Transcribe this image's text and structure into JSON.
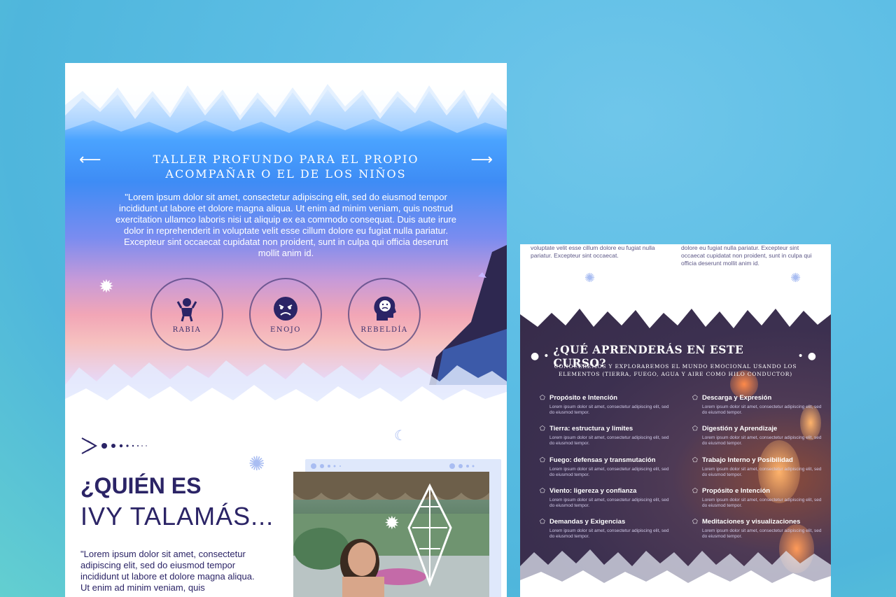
{
  "hero": {
    "title": "Taller profundo para el propio acompañar o el de los niños",
    "arrow_left": "⟵",
    "arrow_right": "⟶",
    "text": "\"Lorem ipsum dolor sit amet, consectetur adipiscing elit, sed do eiusmod tempor incididunt ut labore et dolore magna aliqua. Ut enim ad minim veniam, quis nostrud exercitation ullamco laboris nisi ut aliquip ex ea commodo consequat. Duis aute irure dolor in reprehenderit in voluptate velit esse cillum dolore eu fugiat nulla pariatur. Excepteur sint occaecat cupidatat non proident, sunt in culpa qui officia deserunt mollit anim id.",
    "emotions": [
      {
        "label": "Rabia",
        "icon": "angry-person-icon"
      },
      {
        "label": "Enojo",
        "icon": "angry-face-icon"
      },
      {
        "label": "Rebeldía",
        "icon": "sad-head-icon"
      }
    ]
  },
  "who": {
    "title": "¿QUIÉN ES",
    "name": "IVY TALAMÁS...",
    "text": "\"Lorem ipsum dolor sit amet, consectetur adipiscing elit, sed do eiusmod tempor incididunt ut labore et dolore magna aliqua. Ut enim ad minim veniam, quis"
  },
  "right_page": {
    "top_text_left": "voluptate velit esse cillum dolore eu fugiat nulla pariatur. Excepteur sint occaecat.",
    "top_text_right": "dolore eu fugiat nulla pariatur. Excepteur sint occaecat cupidatat non proident, sunt in culpa qui officia deserunt mollit anim id.",
    "learn_title": "¿QUÉ APRENDERÁS EN ESTE CURSO?",
    "learn_sub": "Conoceremos y exploraremos el mundo emocional usando los elementos (tierra, fuego, agua y aire como hilo conductor)",
    "items_left": [
      {
        "title": "Propósito e Intención",
        "text": "Lorem ipsum dolor sit amet, consectetur adipiscing elit, sed do eiusmod tempor."
      },
      {
        "title": "Tierra: estructura y limites",
        "text": "Lorem ipsum dolor sit amet, consectetur adipiscing elit, sed do eiusmod tempor."
      },
      {
        "title": "Fuego: defensas y transmutación",
        "text": "Lorem ipsum dolor sit amet, consectetur adipiscing elit, sed do eiusmod tempor."
      },
      {
        "title": "Viento: ligereza y confianza",
        "text": "Lorem ipsum dolor sit amet, consectetur adipiscing elit, sed do eiusmod tempor."
      },
      {
        "title": "Demandas y Exigencias",
        "text": "Lorem ipsum dolor sit amet, consectetur adipiscing elit, sed do eiusmod tempor."
      }
    ],
    "items_right": [
      {
        "title": "Descarga y Expresión",
        "text": "Lorem ipsum dolor sit amet, consectetur adipiscing elit, sed do eiusmod tempor."
      },
      {
        "title": "Digestión y Aprendizaje",
        "text": "Lorem ipsum dolor sit amet, consectetur adipiscing elit, sed do eiusmod tempor."
      },
      {
        "title": "Trabajo Interno y Posibilidad",
        "text": "Lorem ipsum dolor sit amet, consectetur adipiscing elit, sed do eiusmod tempor."
      },
      {
        "title": "Propósito e Intención",
        "text": "Lorem ipsum dolor sit amet, consectetur adipiscing elit, sed do eiusmod tempor."
      },
      {
        "title": "Meditaciones y visualizaciones",
        "text": "Lorem ipsum dolor sit amet, consectetur adipiscing elit, sed do eiusmod tempor."
      }
    ]
  },
  "colors": {
    "background": "#5bbde4",
    "navy": "#2b2466",
    "dark_panel": "#3c3050",
    "accent_blue": "#a9bdf2"
  }
}
